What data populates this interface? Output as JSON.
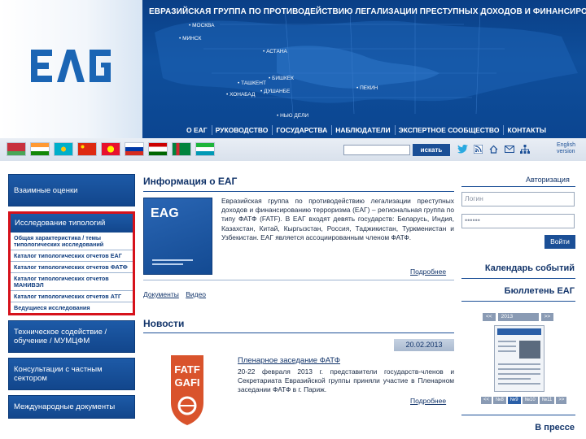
{
  "header": {
    "title": "ЕВРАЗИЙСКАЯ ГРУППА ПО ПРОТИВОДЕЙСТВИЮ ЛЕГАЛИЗАЦИИ ПРЕСТУПНЫХ ДОХОДОВ И ФИНАНСИРОВАНИЮ ТЕРРОРИЗМА",
    "logo_text": "EAG",
    "cities": [
      "МОСКВА",
      "МИНСК",
      "АСТАНА",
      "БИШКЕК",
      "ТАШКЕНТ",
      "ДУШАНБЕ",
      "ХОНАБАД",
      "ПЕКИН",
      "НЬЮ ДЕЛИ"
    ],
    "nav": [
      "О ЕАГ",
      "РУКОВОДСТВО",
      "ГОСУДАРСТВА",
      "НАБЛЮДАТЕЛИ",
      "ЭКСПЕРТНОЕ СООБЩЕСТВО",
      "КОНТАКТЫ"
    ]
  },
  "toolbar": {
    "search_button": "искать",
    "lang_label_1": "English",
    "lang_label_2": "version"
  },
  "sidebar": {
    "mutual": "Взаимные оценки",
    "typology_head": "Исследование типологий",
    "typology_items": [
      "Общая характеристика / темы типологических исследований",
      "Каталог типологических отчетов ЕАГ",
      "Каталог типологических отчетов ФАТФ",
      "Каталог типологических отчетов МАНИВЭЛ",
      "Каталог типологических отчетов АТГ",
      "Ведущиеся исследования"
    ],
    "tech": "Техническое содействие / обучение / МУМЦФМ",
    "private": "Консультации с частным сектором",
    "intl": "Международные документы"
  },
  "main": {
    "info_heading": "Информация о ЕАГ",
    "info_text": "Евразийская группа по противодействию легализации преступных доходов и финансированию терроризма (ЕАГ) – региональная группа по типу ФАТФ (FATF). В ЕАГ входят девять государств: Беларусь, Индия, Казахстан, Китай, Кыргызстан, Россия, Таджикистан, Туркменистан и Узбекистан. ЕАГ является ассоциированным членом ФАТФ.",
    "more": "Подробнее",
    "link_docs": "Документы",
    "link_video": "Видео",
    "news_heading": "Новости",
    "news_date": "20.02.2013",
    "news_title": "Пленарное заседание ФАТФ",
    "news_text": "20-22 февраля 2013 г. представители государств-членов и Секретариата Евразийской группы приняли участие в Пленарном заседании ФАТФ в г. Париж.",
    "fatf_logo_line1": "FATF",
    "fatf_logo_line2": "GAFI"
  },
  "right": {
    "auth": "Авторизация",
    "login_placeholder": "Логин",
    "password_mask": "••••••",
    "enter": "Войти",
    "calendar": "Календарь событий",
    "bulletin": "Бюллетень ЕАГ",
    "press": "В прессе",
    "bulletin_year": "2013",
    "bulletin_pages": [
      "<<",
      "№8",
      "№9",
      "№10",
      "№11",
      ">>"
    ]
  },
  "colors": {
    "banner": "#0f4f9c",
    "accent": "#1b4f96",
    "highlight": "#d6121b"
  }
}
